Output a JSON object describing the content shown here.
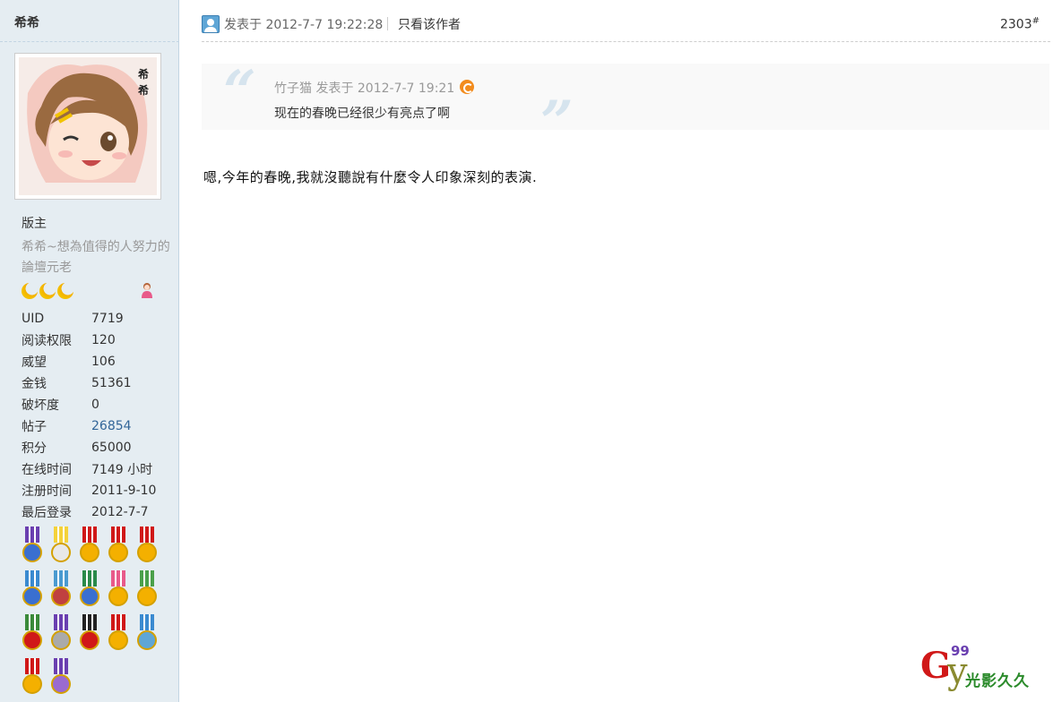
{
  "sidebar": {
    "username": "希希",
    "avatar_label": "希希",
    "group": "版主",
    "custom_title": "希希~想為值得的人努力的論壇元老",
    "stats": [
      {
        "label": "UID",
        "value": "7719"
      },
      {
        "label": "阅读权限",
        "value": "120"
      },
      {
        "label": "威望",
        "value": "106"
      },
      {
        "label": "金钱",
        "value": "51361"
      },
      {
        "label": "破坏度",
        "value": "0"
      },
      {
        "label": "帖子",
        "value": "26854"
      },
      {
        "label": "积分",
        "value": "65000"
      },
      {
        "label": "在线时间",
        "value": "7149 小时"
      },
      {
        "label": "注册时间",
        "value": "2011-9-10"
      },
      {
        "label": "最后登录",
        "value": "2012-7-7"
      }
    ],
    "star_icons": [
      "moon-icon",
      "moon-icon",
      "moon-icon"
    ],
    "medal_count": 17
  },
  "post": {
    "time": "发表于 2012-7-7 19:22:28",
    "only_author": "只看该作者",
    "floor": "2303",
    "floor_suffix": "#",
    "quote": {
      "meta": "竹子猫 发表于 2012-7-7 19:21",
      "text": "现在的春晚已经很少有亮点了啊"
    },
    "body": "嗯,今年的春晚,我就沒聽說有什麼令人印象深刻的表演."
  },
  "watermark": {
    "g": "G",
    "y": "y",
    "num": "99",
    "text": "光影久久"
  },
  "colors": {
    "sidebar_bg": "#e5edf2",
    "link": "#336699"
  }
}
